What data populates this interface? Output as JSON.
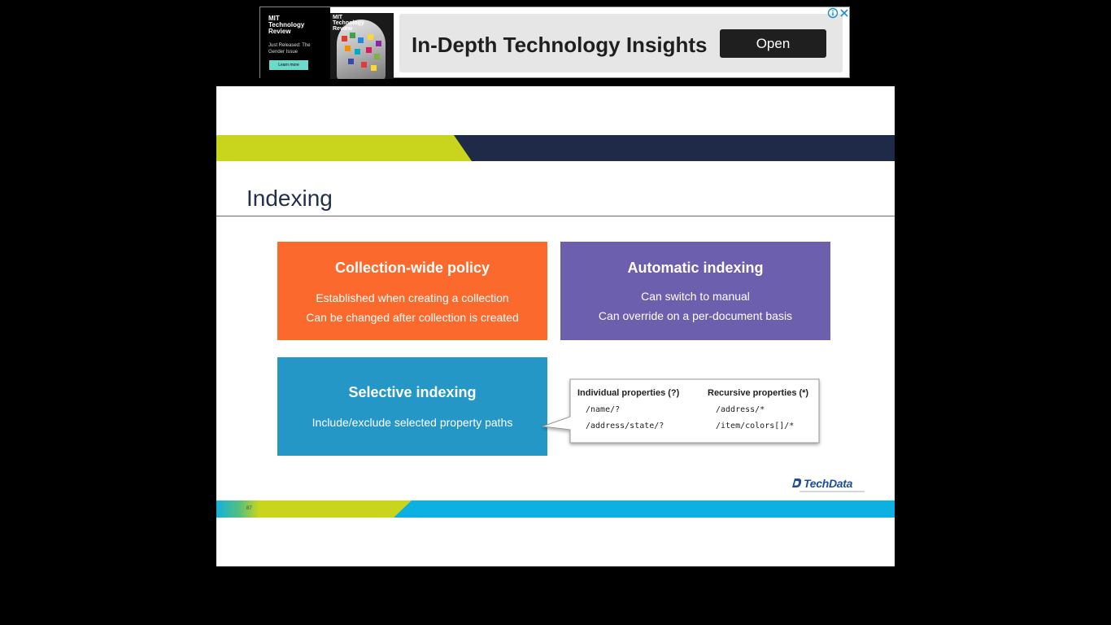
{
  "ad": {
    "brand": "MIT Technology Review",
    "tagline": "Just Released: The Gender Issue",
    "learn_more": "Learn more",
    "cover_title": "MIT Technology Review",
    "headline": "In-Depth Technology Insights",
    "open_label": "Open"
  },
  "slide": {
    "title": "Indexing",
    "boxes": {
      "collection": {
        "title": "Collection-wide policy",
        "lines": [
          "Established when creating a collection",
          "Can be changed after collection is created"
        ]
      },
      "automatic": {
        "title": "Automatic indexing",
        "lines": [
          "Can switch to manual",
          "Can override on a per-document basis"
        ]
      },
      "selective": {
        "title": "Selective indexing",
        "lines": [
          "Include/exclude selected property paths"
        ]
      }
    },
    "callout": {
      "col1_header": "Individual properties (?)",
      "col1_paths": [
        "/name/?",
        "/address/state/?"
      ],
      "col2_header": "Recursive properties (*)",
      "col2_paths": [
        "/address/*",
        "/item/colors[]/*"
      ]
    },
    "logo": "TechData",
    "page_number": "87"
  },
  "colors": {
    "lime": "#c8d51c",
    "navy": "#1e2a47",
    "orange": "#fb6a2c",
    "purple": "#6c5fad",
    "blue": "#2497c6",
    "cyan": "#0cb1e2"
  }
}
